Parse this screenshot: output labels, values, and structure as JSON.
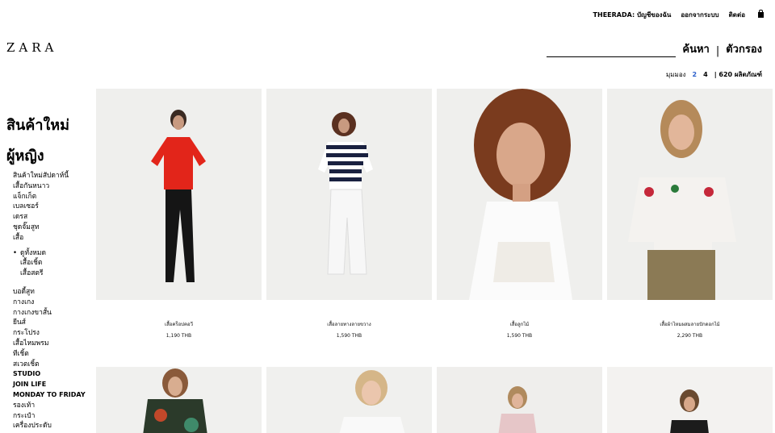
{
  "header": {
    "account": "THEERADA: บัญชีของฉัน",
    "logout": "ออกจากระบบ",
    "contact": "ติดต่อ",
    "brand": "ZARA"
  },
  "search": {
    "search_label": "ค้นหา",
    "separator": "|",
    "filter_label": "ตัวกรอง"
  },
  "view": {
    "label": "มุมมอง",
    "opt1": "2",
    "opt2": "4",
    "count": "| 620 ผลิตภัณฑ์"
  },
  "sidebar": {
    "new_label": "สินค้าใหม่",
    "women_label": "ผู้หญิง",
    "items": [
      "สินค้าใหม่สัปดาห์นี้",
      "เสื้อกันหนาว",
      "แจ็กเก็ต",
      "เบลเซอร์",
      "เดรส",
      "ชุดจั๊มสูท",
      "เสื้อ"
    ],
    "shirt_sub": [
      "ดูทั้งหมด",
      "เสื้อเชิ้ต",
      "เสื้อสตรี"
    ],
    "items2": [
      "บอดี้สูท",
      "กางเกง",
      "กางเกงขาสั้น",
      "ยีนส์",
      "กระโปรง",
      "เสื้อไหมพรม",
      "ทีเชิ้ต",
      "สเวตเชิ้ต",
      "STUDIO",
      "JOIN LIFE",
      "MONDAY TO FRIDAY",
      "รองเท้า",
      "กระเป๋า",
      "เครื่องประดับ"
    ]
  },
  "products": [
    {
      "name": "เสื้อคร็อปคอวี",
      "price": "1,190 THB"
    },
    {
      "name": "เสื้อลายทางลายขวาง",
      "price": "1,590 THB"
    },
    {
      "name": "เสื้อลูกไม้",
      "price": "1,590 THB"
    },
    {
      "name": "เสื้อผ้าไหมผสมลายปักดอกไม้",
      "price": "2,290 THB"
    }
  ],
  "colors": {
    "accent": "#2a5fcb",
    "bg": "#efefed"
  }
}
